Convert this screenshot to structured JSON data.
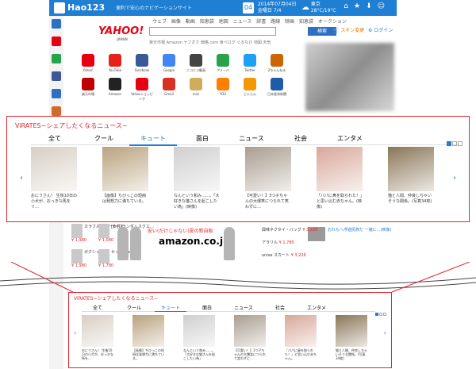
{
  "app": {
    "title": "Hao123",
    "tagline": "便利で安心のナビゲーションサイト"
  },
  "topbar": {
    "date_day": "04",
    "date_line1": "2014年07月04日",
    "date_line2": "金曜日 7/4",
    "weather_line1": "東京",
    "weather_line2": "28°C/19°C"
  },
  "nav": {
    "items": [
      "ウェブ",
      "画像",
      "動画",
      "知恵袋",
      "地図",
      "ニュース",
      "辞書",
      "路線",
      "映画",
      "知恵袋",
      "オークション"
    ]
  },
  "search": {
    "brand": "YAHOO!",
    "brand_sub": "JAPAN",
    "button": "検索",
    "sublinks": "楽天市場  Amazon  ヤフオク  価格.com  食べログ  ぐるなび  地図  天気"
  },
  "top_actions": {
    "skin": "スキン変更",
    "settings": "ログイン"
  },
  "icon_grid": [
    {
      "label": "Yahoo!",
      "color": "#e60012"
    },
    {
      "label": "YouTube",
      "color": "#e62117"
    },
    {
      "label": "Facebook",
      "color": "#3b5998"
    },
    {
      "label": "Google",
      "color": "#4285f4"
    },
    {
      "label": "ニコニコ動画",
      "color": "#444444"
    },
    {
      "label": "アメーバ",
      "color": "#2aa14a"
    },
    {
      "label": "Twitter",
      "color": "#1da1f2"
    },
    {
      "label": "2ちゃんねる",
      "color": "#cc6600"
    },
    {
      "label": "楽天市場",
      "color": "#bf0000"
    },
    {
      "label": "Amazon",
      "color": "#222222"
    },
    {
      "label": "Yahooショッピング",
      "color": "#e60012"
    },
    {
      "label": "Gmail",
      "color": "#d93025"
    },
    {
      "label": "mixi",
      "color": "#d1ad5a"
    },
    {
      "label": "YOU",
      "color": "#ff7f00"
    },
    {
      "label": "じゃらん",
      "color": "#f39800"
    },
    {
      "label": "日本経済新聞",
      "color": "#1e5ba8"
    }
  ],
  "widget": {
    "title": "ViRATES−シェアしたくなるニュース−",
    "tabs": [
      "全て",
      "クール",
      "キュート",
      "面白",
      "ニュース",
      "社会",
      "エンタメ"
    ],
    "active_tab_index": 2,
    "cards": [
      {
        "caption": "おにうさん！ 生後10日の小犬が、おっきな馬をリ…",
        "color": "#d8cfc4"
      },
      {
        "caption": "【画像】ちびっこの短冊は発想力に満ちている。",
        "color": "#b9a27f"
      },
      {
        "caption": "なんという和み……。「大好きな猫さんを起こしたい為」(映像)",
        "color": "#cfcfcf"
      },
      {
        "caption": "【可愛い！】3つ子ちゃんの大爆笑につられて笑わずに…",
        "color": "#a99d8f"
      },
      {
        "caption": "「パパに鼻を取られた！」と思い込む赤ちゃん。(映像)",
        "color": "#d7a89a"
      },
      {
        "caption": "猫と人間、仲良しちゃいそうな関係。(写真34枚)",
        "color": "#8a7658"
      }
    ]
  },
  "ads": {
    "left": [
      {
        "name": "カラフルシューティス…",
        "price": "¥ 1,980"
      },
      {
        "name": "[女性]ランダムスクエ…",
        "price": "¥ 1,080"
      },
      {
        "name": "ボクシャル",
        "price": "¥ 1,980"
      },
      {
        "name": "セットチェス…",
        "price": "¥ 1,780"
      }
    ],
    "banner_head": "安い(だけじゃない)夏の新自販",
    "banner_logo": "amazon.co.jp",
    "right_items": [
      {
        "name": "興味ネクタイ・バッグ",
        "price": "¥ 3,226"
      },
      {
        "name": "アラリル",
        "price": "¥ 1,780"
      },
      {
        "name": "unise スカート",
        "price": "¥ 3,226"
      }
    ],
    "right_text": "おれもへ浮遊民族だ 一緒に…(映像)"
  },
  "widget_small": {
    "title": "ViRATES−シェアしたくなるニュース−",
    "tabs": [
      "全て",
      "クール",
      "キュート",
      "面白",
      "ニュース",
      "社会",
      "エンタメ"
    ],
    "active_tab_index": 2,
    "cards": [
      {
        "caption": "おにうさん！ 生後10日の小犬が、おっきな馬を…",
        "color": "#d8cfc4"
      },
      {
        "caption": "【画像】ちびっこの短冊は発想力に満ちている。",
        "color": "#b9a27f"
      },
      {
        "caption": "なんという和み……。「大好きな猫さんを起こしたい為」",
        "color": "#cfcfcf"
      },
      {
        "caption": "【可愛い！】3つ子ちゃんの大爆笑につられて笑わずに…",
        "color": "#a99d8f"
      },
      {
        "caption": "「パパに鼻を取られた！」と思い込む赤ちゃん。",
        "color": "#d7a89a"
      },
      {
        "caption": "猫と人間、仲良しちゃいそうな関係。(写真34枚)",
        "color": "#8a7658"
      }
    ]
  },
  "left_strip_colors": [
    "#2c6fc4",
    "#e60012",
    "#22a54d",
    "#3b5998",
    "#2c6fc4",
    "#d06a2a",
    "#9a54c4"
  ]
}
